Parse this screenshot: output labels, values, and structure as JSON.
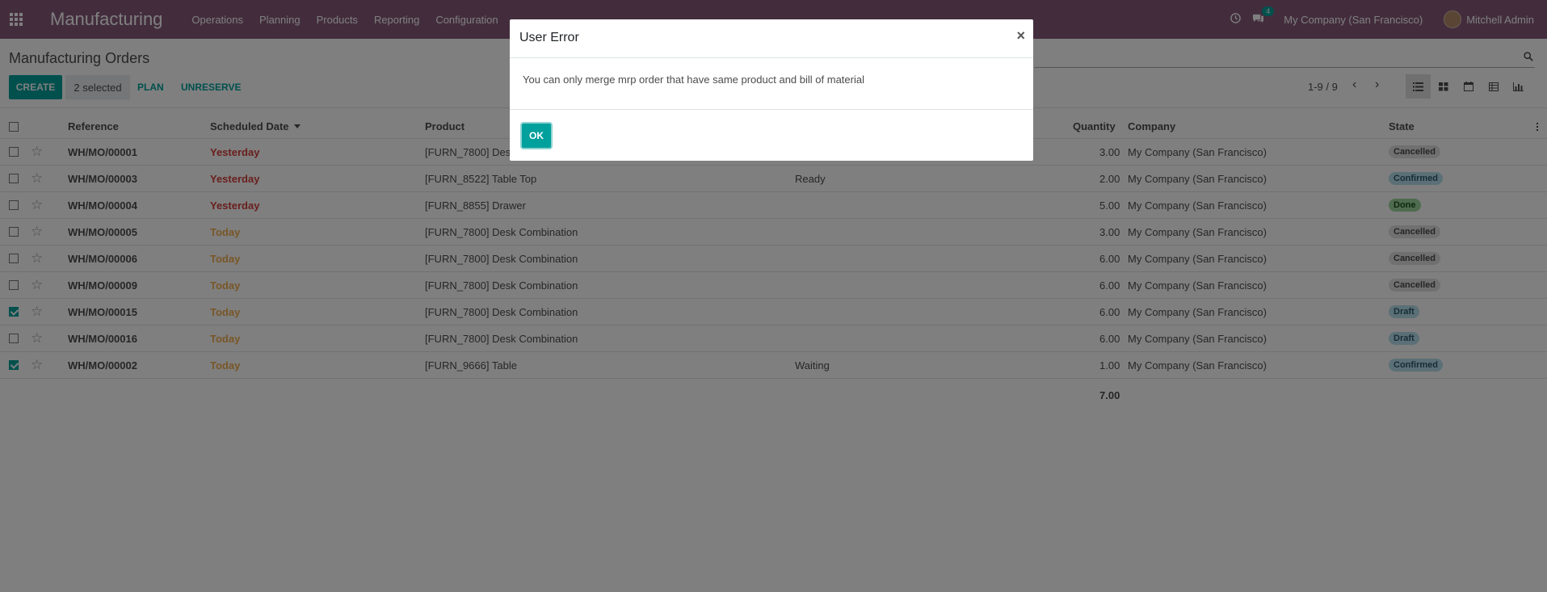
{
  "navbar": {
    "app_name": "Manufacturing",
    "menu": [
      "Operations",
      "Planning",
      "Products",
      "Reporting",
      "Configuration"
    ],
    "messages_count": "4",
    "company": "My Company (San Francisco)",
    "user": "Mitchell Admin"
  },
  "control": {
    "title": "Manufacturing Orders",
    "create_label": "CREATE",
    "selected_label": "2 selected",
    "plan_label": "PLAN",
    "unreserve_label": "UNRESERVE",
    "pager": "1-9 / 9"
  },
  "table": {
    "headers": {
      "reference": "Reference",
      "scheduled_date": "Scheduled Date",
      "product": "Product",
      "quantity": "Quantity",
      "company": "Company",
      "state": "State"
    },
    "rows": [
      {
        "checked": false,
        "reference": "WH/MO/00001",
        "date": "Yesterday",
        "date_kind": "yesterday",
        "product": "[FURN_7800] Desk Combination",
        "availability": "",
        "quantity": "3.00",
        "company": "My Company (San Francisco)",
        "state": "Cancelled",
        "state_kind": "cancelled"
      },
      {
        "checked": false,
        "reference": "WH/MO/00003",
        "date": "Yesterday",
        "date_kind": "yesterday",
        "product": "[FURN_8522] Table Top",
        "availability": "Ready",
        "quantity": "2.00",
        "company": "My Company (San Francisco)",
        "state": "Confirmed",
        "state_kind": "confirmed"
      },
      {
        "checked": false,
        "reference": "WH/MO/00004",
        "date": "Yesterday",
        "date_kind": "yesterday",
        "product": "[FURN_8855] Drawer",
        "availability": "",
        "quantity": "5.00",
        "company": "My Company (San Francisco)",
        "state": "Done",
        "state_kind": "done"
      },
      {
        "checked": false,
        "reference": "WH/MO/00005",
        "date": "Today",
        "date_kind": "today",
        "product": "[FURN_7800] Desk Combination",
        "availability": "",
        "quantity": "3.00",
        "company": "My Company (San Francisco)",
        "state": "Cancelled",
        "state_kind": "cancelled"
      },
      {
        "checked": false,
        "reference": "WH/MO/00006",
        "date": "Today",
        "date_kind": "today",
        "product": "[FURN_7800] Desk Combination",
        "availability": "",
        "quantity": "6.00",
        "company": "My Company (San Francisco)",
        "state": "Cancelled",
        "state_kind": "cancelled"
      },
      {
        "checked": false,
        "reference": "WH/MO/00009",
        "date": "Today",
        "date_kind": "today",
        "product": "[FURN_7800] Desk Combination",
        "availability": "",
        "quantity": "6.00",
        "company": "My Company (San Francisco)",
        "state": "Cancelled",
        "state_kind": "cancelled"
      },
      {
        "checked": true,
        "reference": "WH/MO/00015",
        "date": "Today",
        "date_kind": "today",
        "product": "[FURN_7800] Desk Combination",
        "availability": "",
        "quantity": "6.00",
        "company": "My Company (San Francisco)",
        "state": "Draft",
        "state_kind": "draft"
      },
      {
        "checked": false,
        "reference": "WH/MO/00016",
        "date": "Today",
        "date_kind": "today",
        "product": "[FURN_7800] Desk Combination",
        "availability": "",
        "quantity": "6.00",
        "company": "My Company (San Francisco)",
        "state": "Draft",
        "state_kind": "draft"
      },
      {
        "checked": true,
        "reference": "WH/MO/00002",
        "date": "Today",
        "date_kind": "today",
        "product": "[FURN_9666] Table",
        "availability": "Waiting",
        "quantity": "1.00",
        "company": "My Company (San Francisco)",
        "state": "Confirmed",
        "state_kind": "confirmed"
      }
    ],
    "total_quantity": "7.00"
  },
  "dialog": {
    "title": "User Error",
    "close_symbol": "×",
    "message": "You can only merge mrp order that have same product and bill of material",
    "ok_label": "OK"
  }
}
